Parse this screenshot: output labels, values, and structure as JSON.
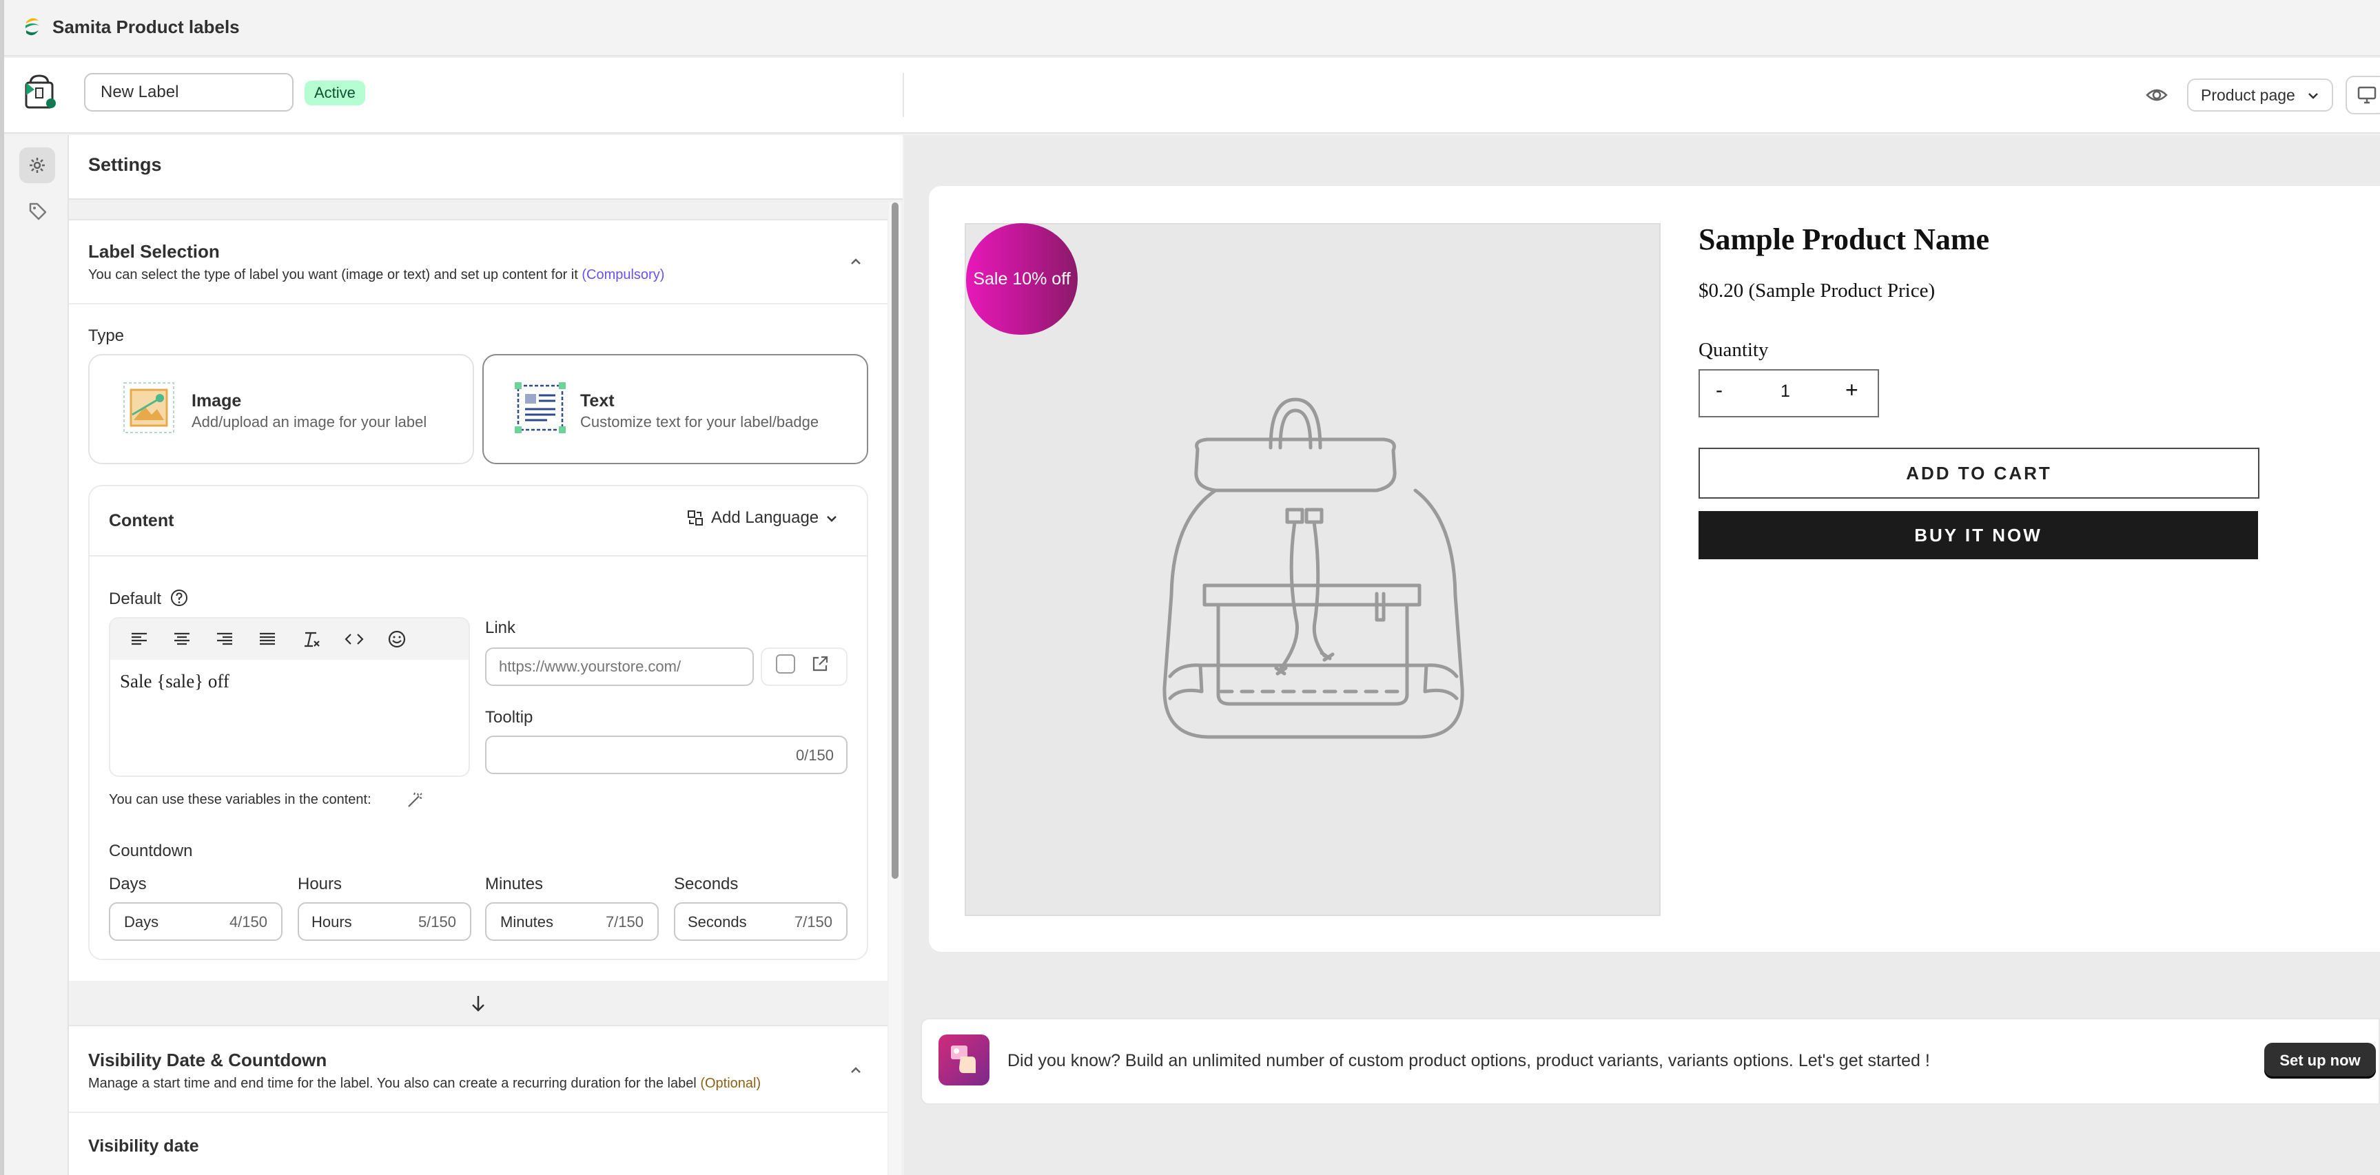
{
  "app": {
    "title": "Samita Product labels"
  },
  "toolbar": {
    "label_name": "New Label",
    "status": "Active",
    "page_select": "Product page"
  },
  "settings": {
    "title": "Settings",
    "label_selection": {
      "title": "Label Selection",
      "description": "You can select the type of label you want (image or text) and set up content for it",
      "tag": "(Compulsory)"
    },
    "type": {
      "label": "Type",
      "image": {
        "title": "Image",
        "description": "Add/upload an image for your label"
      },
      "text": {
        "title": "Text",
        "description": "Customize text for your label/badge"
      },
      "selected": "Text"
    },
    "content": {
      "title": "Content",
      "add_language": "Add Language",
      "default_label": "Default",
      "editor_text": "Sale {sale} off",
      "link_label": "Link",
      "link_placeholder": "https://www.yourstore.com/",
      "tooltip_label": "Tooltip",
      "tooltip_counter": "0/150",
      "variables_note": "You can use these variables in the content:"
    },
    "countdown": {
      "label": "Countdown",
      "fields": [
        {
          "label": "Days",
          "value": "Days",
          "count": "4/150"
        },
        {
          "label": "Hours",
          "value": "Hours",
          "count": "5/150"
        },
        {
          "label": "Minutes",
          "value": "Minutes",
          "count": "7/150"
        },
        {
          "label": "Seconds",
          "value": "Seconds",
          "count": "7/150"
        }
      ]
    },
    "visibility": {
      "title": "Visibility Date & Countdown",
      "description": "Manage a start time and end time for the label. You also can create a recurring duration for the label",
      "tag": "(Optional)",
      "date_label": "Visibility date"
    }
  },
  "preview": {
    "badge_text": "Sale 10% off",
    "product_name": "Sample Product Name",
    "product_price": "$0.20 (Sample Product Price)",
    "quantity_label": "Quantity",
    "quantity_minus": "-",
    "quantity_value": "1",
    "quantity_plus": "+",
    "add_to_cart": "ADD TO CART",
    "buy_it_now": "BUY IT NOW"
  },
  "promo": {
    "text": "Did you know? Build an unlimited number of custom product options, product variants, variants options. Let's get started !",
    "button": "Set up now"
  },
  "colors": {
    "badge_gradient_start": "#e619b8",
    "badge_gradient_end": "#8b1a6a",
    "status_badge_bg": "#b4fed2",
    "compulsory_tag": "#6c4ff5",
    "optional_tag": "#8a6116"
  }
}
